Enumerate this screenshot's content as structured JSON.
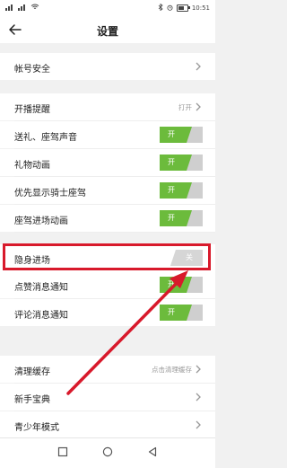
{
  "header": {
    "title": "设置"
  },
  "statusbar": {
    "time": "10:51"
  },
  "rows": [
    {
      "label": "帐号安全",
      "kind": "chevron"
    },
    {
      "label": "开播提醒",
      "kind": "value",
      "value": "打开"
    },
    {
      "label": "送礼、座驾声音",
      "kind": "toggle",
      "state": "开"
    },
    {
      "label": "礼物动画",
      "kind": "toggle",
      "state": "开"
    },
    {
      "label": "优先显示骑士座驾",
      "kind": "toggle",
      "state": "开"
    },
    {
      "label": "座驾进场动画",
      "kind": "toggle",
      "state": "开"
    },
    {
      "label": "隐身进场",
      "kind": "toggle",
      "state": "关"
    },
    {
      "label": "点赞消息通知",
      "kind": "toggle",
      "state": "开"
    },
    {
      "label": "评论消息通知",
      "kind": "toggle",
      "state": "开"
    },
    {
      "label": "清理缓存",
      "kind": "value",
      "value": "点击清理缓存"
    },
    {
      "label": "新手宝典",
      "kind": "chevron"
    },
    {
      "label": "青少年模式",
      "kind": "chevron"
    }
  ],
  "colors": {
    "toggle_on": "#6cbb3c",
    "toggle_off": "#cfcfcf",
    "highlight": "#d8192b"
  },
  "icons": {
    "back": "arrow-left-icon",
    "chevron": "chevron-right-icon"
  }
}
